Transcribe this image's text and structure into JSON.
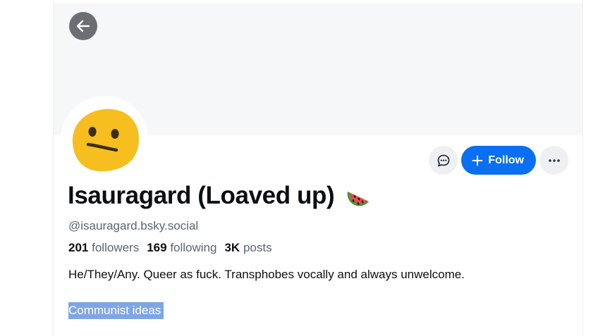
{
  "profile": {
    "display_name": "Isauragard (Loaved up)",
    "display_name_emoji": "watermelon-icon",
    "handle": "@isauragard.bsky.social",
    "stats": {
      "followers_count": "201",
      "followers_label": "followers",
      "following_count": "169",
      "following_label": "following",
      "posts_count": "3K",
      "posts_label": "posts"
    },
    "bio": "He/They/Any. Queer as fuck. Transphobes vocally and always unwelcome.",
    "selected_text": "Communist ideas"
  },
  "actions": {
    "follow_label": "Follow"
  },
  "icons": {
    "back": "arrow-left-icon",
    "message": "chat-bubble-icon",
    "follow": "plus-icon",
    "more": "ellipsis-icon",
    "avatar": "neutral-face-icon"
  },
  "colors": {
    "accent": "#0a6ff2",
    "selection": "#7ea6e6",
    "muted_text": "#5a6573",
    "banner": "#f6f7f9"
  }
}
